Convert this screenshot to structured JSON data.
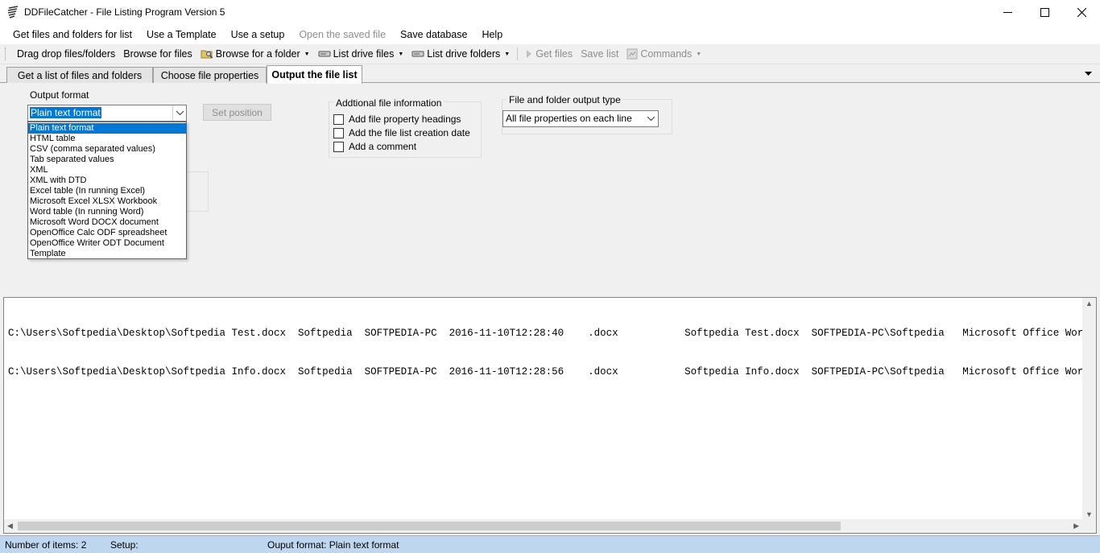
{
  "window": {
    "title": "DDFileCatcher - File Listing Program Version 5"
  },
  "menu": [
    {
      "label": "Get files and folders for list",
      "disabled": false
    },
    {
      "label": "Use a Template",
      "disabled": false
    },
    {
      "label": "Use a setup",
      "disabled": false
    },
    {
      "label": "Open the saved file",
      "disabled": true
    },
    {
      "label": "Save database",
      "disabled": false
    },
    {
      "label": "Help",
      "disabled": false
    }
  ],
  "toolbar": {
    "drag_drop": "Drag drop files/folders",
    "browse_files": "Browse for files",
    "browse_folder": "Browse for a folder",
    "list_drive_files": "List drive files",
    "list_drive_folders": "List drive folders",
    "get_files": "Get files",
    "save_list": "Save list",
    "commands": "Commands"
  },
  "tabs": [
    {
      "label": "Get a list of files and folders",
      "active": false
    },
    {
      "label": "Choose file properties",
      "active": false
    },
    {
      "label": "Output the file list",
      "active": true
    }
  ],
  "output_format": {
    "label": "Output format",
    "value": "Plain text format",
    "set_position": "Set position",
    "options": [
      "Plain text format",
      "HTML table",
      "CSV (comma separated values)",
      "Tab separated values",
      "XML",
      "XML with DTD",
      "Excel table (In running Excel)",
      "Microsoft Excel XLSX Workbook",
      "Word table (In running Word)",
      "Microsoft Word DOCX document",
      "OpenOffice Calc ODF spreadsheet",
      "OpenOffice Writer ODT Document",
      "Template"
    ]
  },
  "additional_info": {
    "title": "Addtional file information",
    "add_headings": "Add file property headings",
    "add_creation_date": "Add the file list creation date",
    "add_comment": "Add a comment"
  },
  "output_type": {
    "title": "File and folder output type",
    "value": "All file properties on each line"
  },
  "output_lines": [
    "C:\\Users\\Softpedia\\Desktop\\Softpedia Test.docx  Softpedia  SOFTPEDIA-PC  2016-11-10T12:28:40    .docx           Softpedia Test.docx  SOFTPEDIA-PC\\Softpedia   Microsoft Office Word",
    "C:\\Users\\Softpedia\\Desktop\\Softpedia Info.docx  Softpedia  SOFTPEDIA-PC  2016-11-10T12:28:56    .docx           Softpedia Info.docx  SOFTPEDIA-PC\\Softpedia   Microsoft Office Word"
  ],
  "status": {
    "items": "Number of items: 2",
    "setup": "Setup:",
    "format": "Ouput format: Plain text format"
  },
  "colors": {
    "selection": "#0078d7",
    "statusbar": "#bfd6ef"
  }
}
